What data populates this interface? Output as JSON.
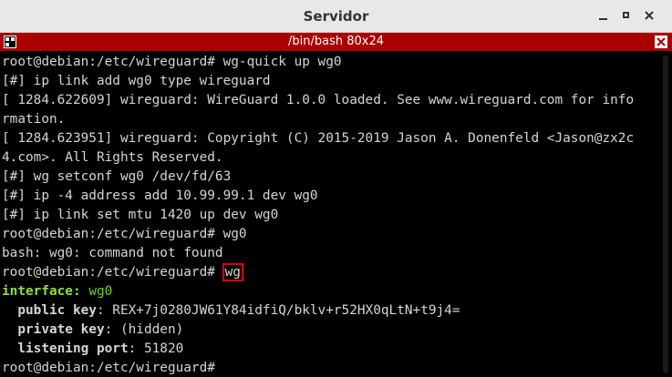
{
  "window": {
    "title": "Servidor"
  },
  "tab": {
    "title": "/bin/bash 80x24"
  },
  "colors": {
    "tab_bar": "#aa0000",
    "terminal_bg": "#000000",
    "terminal_fg": "#d3d7cf",
    "keyword_green": "#8ae234",
    "highlight_box": "#e00000"
  },
  "icons": {
    "minimize": "minimize-icon",
    "maximize": "maximize-icon",
    "close": "close-icon",
    "terminal_menu": "terminal-menu-icon",
    "tab_close": "tab-close-icon"
  },
  "terminal": {
    "lines": [
      "root@debian:/etc/wireguard# wg-quick up wg0",
      "[#] ip link add wg0 type wireguard",
      "[ 1284.622609] wireguard: WireGuard 1.0.0 loaded. See www.wireguard.com for info",
      "rmation.",
      "[ 1284.623951] wireguard: Copyright (C) 2015-2019 Jason A. Donenfeld <Jason@zx2c",
      "4.com>. All Rights Reserved.",
      "[#] wg setconf wg0 /dev/fd/63",
      "[#] ip -4 address add 10.99.99.1 dev wg0",
      "[#] ip link set mtu 1420 up dev wg0",
      "root@debian:/etc/wireguard# wg0",
      "bash: wg0: command not found"
    ],
    "prompt": "root@debian:/etc/wireguard# ",
    "highlighted_command": "wg",
    "interface_label": "interface",
    "interface_name": "wg0",
    "public_key_label": "public key",
    "public_key_value": "REX+7j0280JW61Y84idfiQ/bklv+r52HX0qLtN+t9j4=",
    "private_key_label": "private key",
    "private_key_value": "(hidden)",
    "listening_port_label": "listening port",
    "listening_port_value": "51820",
    "final_prompt": "root@debian:/etc/wireguard# "
  }
}
